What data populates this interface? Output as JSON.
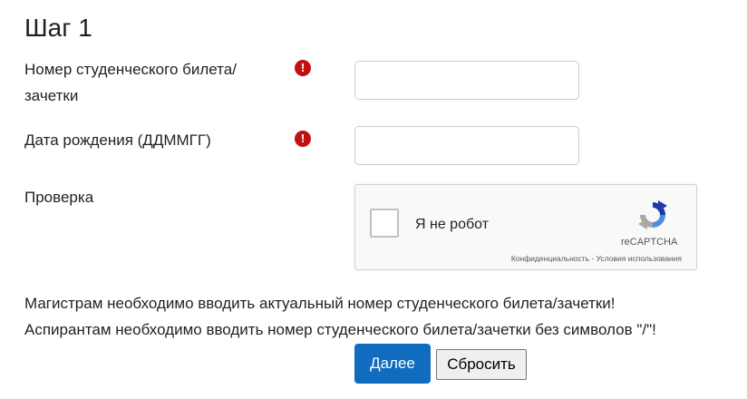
{
  "page": {
    "heading": "Шаг 1"
  },
  "form": {
    "student_id": {
      "label": "Номер студенческого билета/ зачетки",
      "value": "",
      "required_icon": "exclamation-circle-icon"
    },
    "birth_date": {
      "label": "Дата рождения (ДДММГГ)",
      "value": "",
      "required_icon": "exclamation-circle-icon"
    },
    "verification": {
      "label": "Проверка"
    }
  },
  "captcha": {
    "checkbox_label": "Я не робот",
    "brand": "reCAPTCHA",
    "privacy": "Конфиденциальность",
    "separator": " - ",
    "terms": "Условия использования"
  },
  "notes": [
    "Магистрам необходимо вводить актуальный номер студенческого билета/зачетки!",
    "Аспирантам необходимо вводить номер студенческого билета/зачетки без символов \"/\"!"
  ],
  "buttons": {
    "next": "Далее",
    "reset": "Сбросить"
  },
  "colors": {
    "primary": "#0f6cbf",
    "required": "#c20f0f"
  }
}
